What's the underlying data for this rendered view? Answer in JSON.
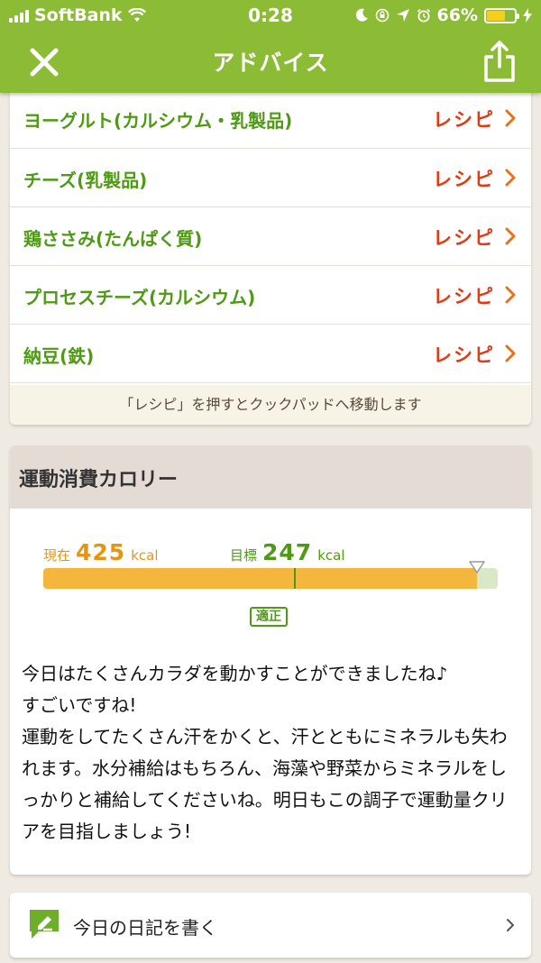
{
  "status_bar": {
    "carrier": "SoftBank",
    "time": "0:28",
    "battery_percent": "66%",
    "battery_level": 0.66,
    "icons": [
      "signal-icon",
      "wifi-icon",
      "moon-icon",
      "rotation-lock-icon",
      "location-icon",
      "alarm-icon",
      "battery-icon",
      "charging-icon"
    ]
  },
  "nav": {
    "title": "アドバイス",
    "close_icon": "close-icon",
    "share_icon": "share-icon"
  },
  "recipe_list": {
    "items": [
      {
        "name": "ヨーグルト(カルシウム・乳製品)",
        "action": "レシピ"
      },
      {
        "name": "チーズ(乳製品)",
        "action": "レシピ"
      },
      {
        "name": "鶏ささみ(たんぱく質)",
        "action": "レシピ"
      },
      {
        "name": "プロセスチーズ(カルシウム)",
        "action": "レシピ"
      },
      {
        "name": "納豆(鉄)",
        "action": "レシピ"
      }
    ],
    "footer_note": "「レシピ」を押すとクックパッドへ移動します"
  },
  "exercise": {
    "title": "運動消費カロリー",
    "current_label": "現在",
    "current_value": "425",
    "current_value_num": 425,
    "target_label": "目標",
    "target_value": "247",
    "target_value_num": 247,
    "unit": "kcal",
    "status": "適正",
    "gauge_fill_fraction": 0.955,
    "gauge_target_fraction": 0.553,
    "advice": "今日はたくさんカラダを動かすことができましたね♪\nすごいですね!\n運動をしてたくさん汗をかくと、汗とともにミネラルも失われます。水分補給はもちろん、海藻や野菜からミネラルをしっかりと補給してくださいね。明日もこの調子で運動量クリアを目指しましょう!"
  },
  "diary": {
    "label": "今日の日記を書く",
    "icon": "pencil-note-icon"
  },
  "colors": {
    "brand_green": "#8cbb35",
    "text_green": "#4f9a14",
    "recipe_red": "#e03a16",
    "gauge_orange": "#f5b63e",
    "current_orange": "#e49613"
  }
}
